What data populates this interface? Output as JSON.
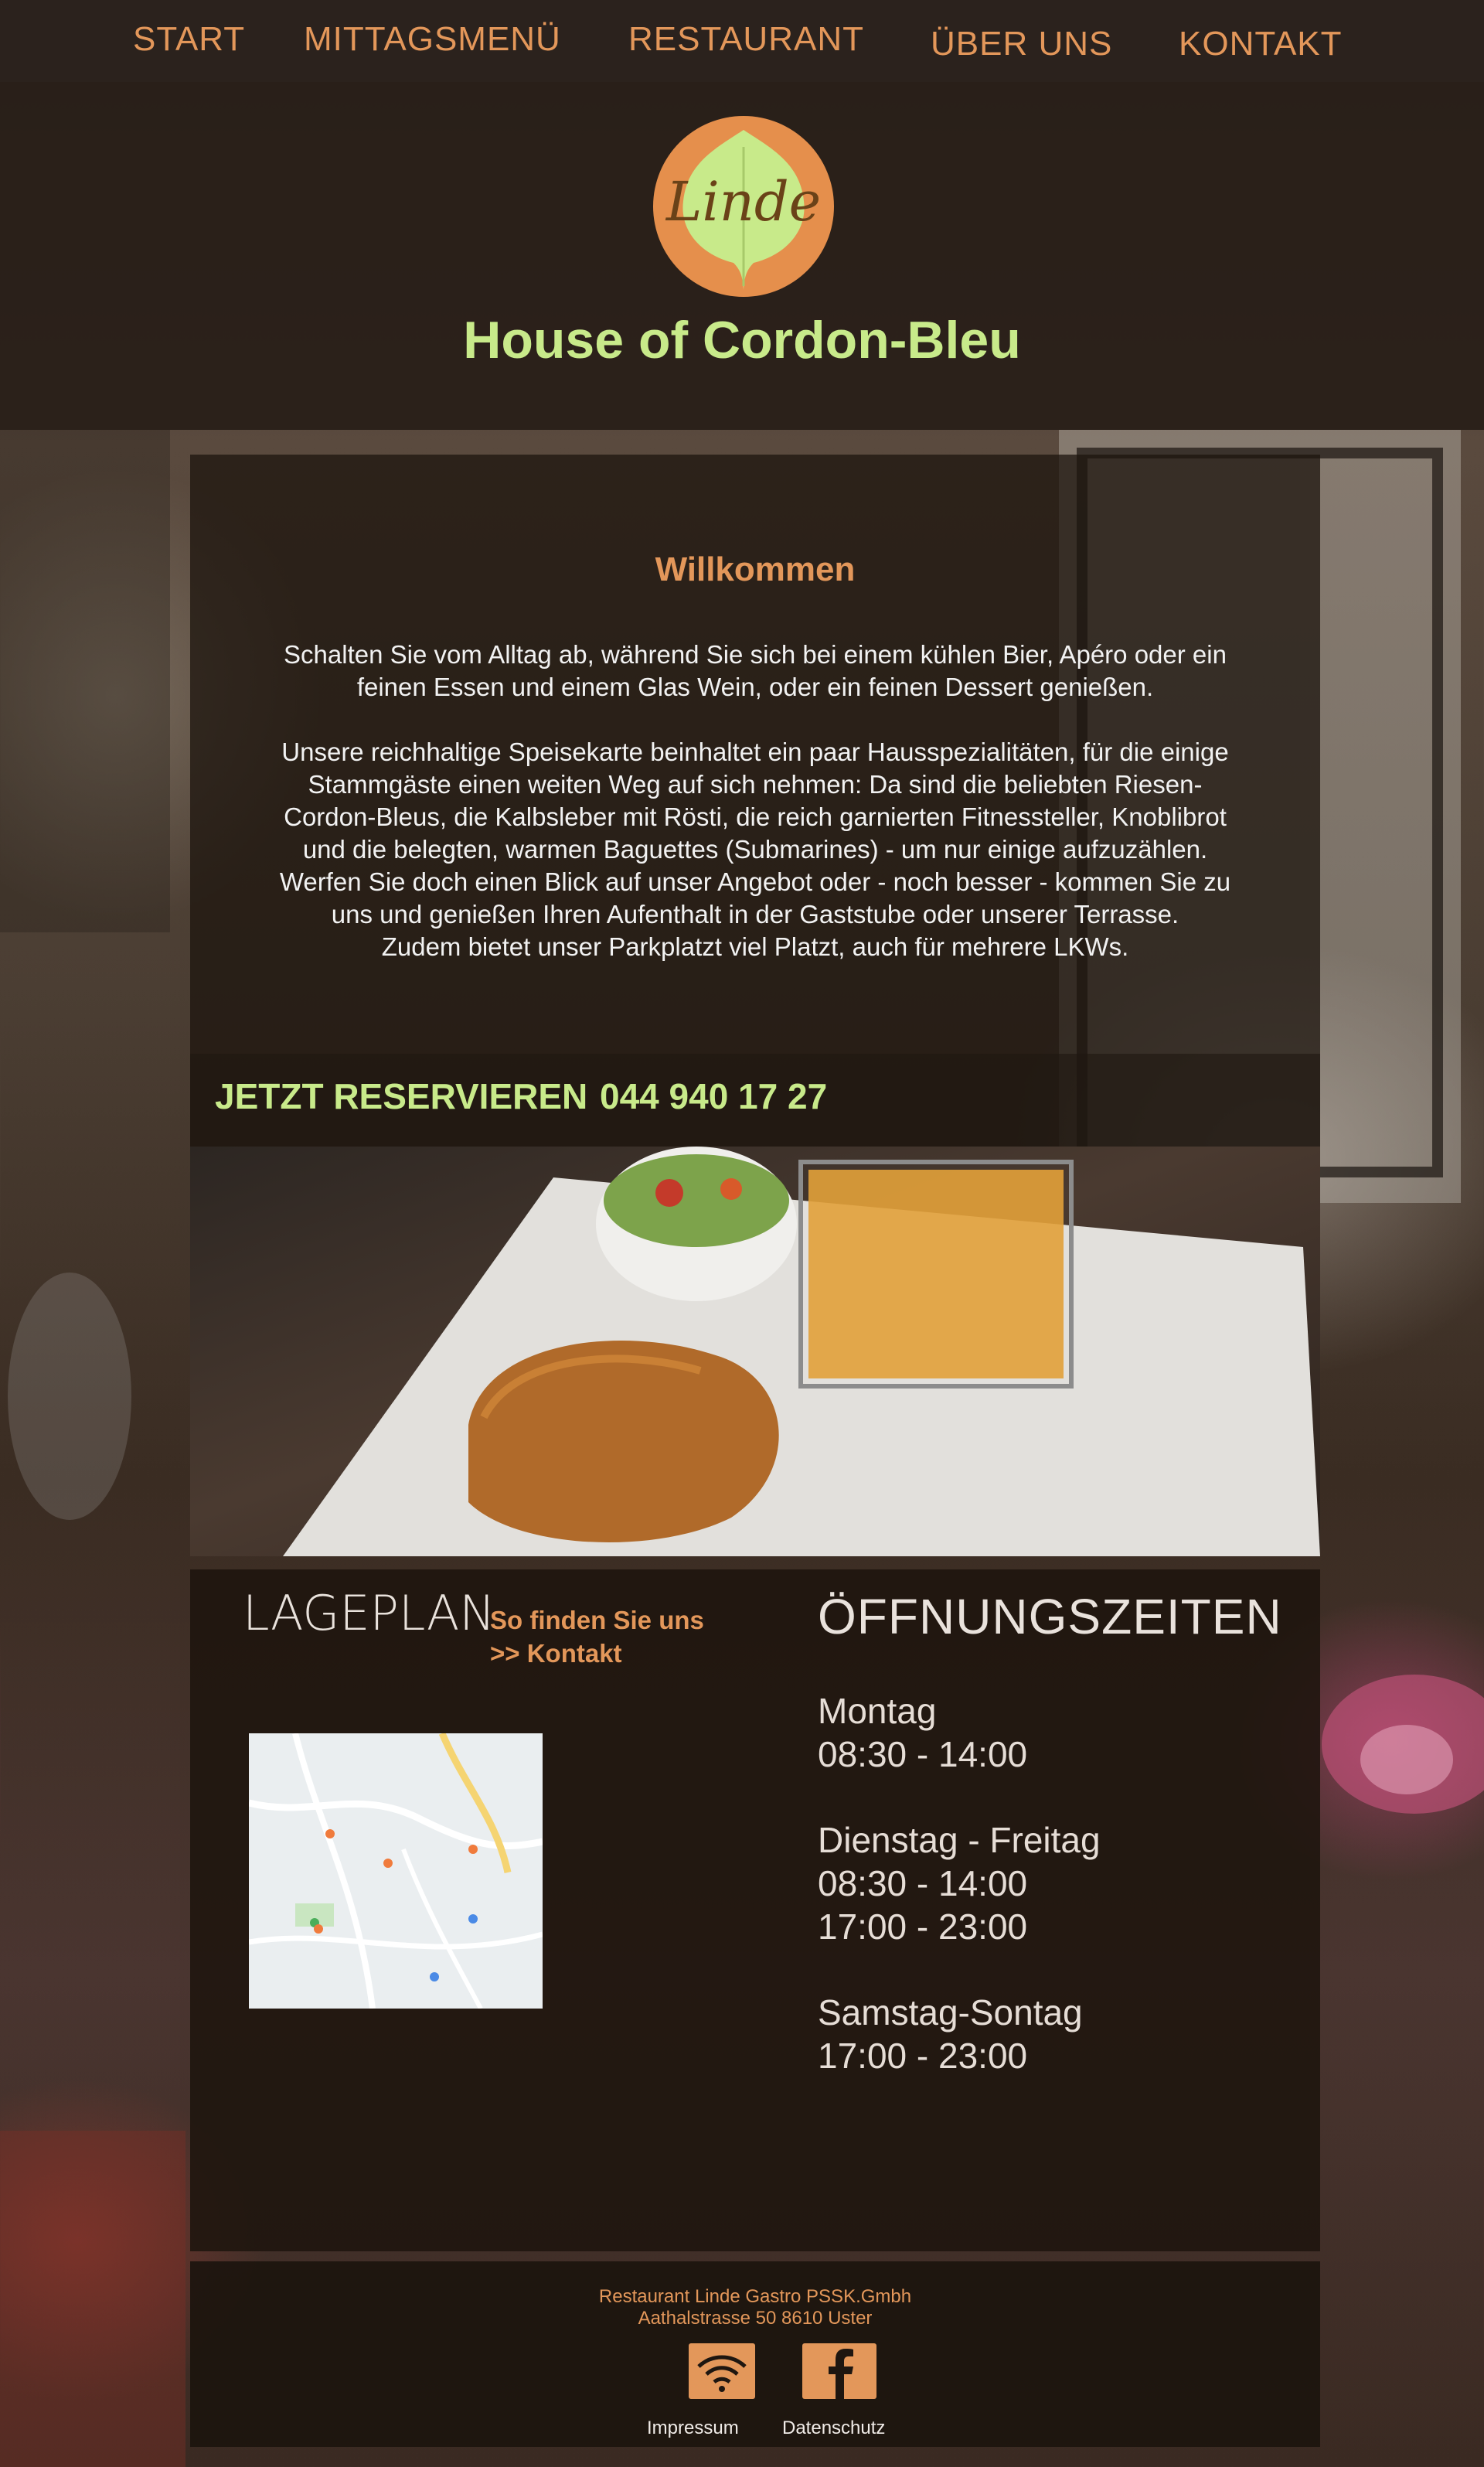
{
  "nav": {
    "items": [
      "START",
      "MITTAGSMENÜ",
      "RESTAURANT",
      "ÜBER UNS",
      "KONTAKT"
    ]
  },
  "header": {
    "logo_text": "Linde",
    "site_title": "House of Cordon-Bleu"
  },
  "welcome": {
    "title": "Willkommen",
    "paragraph1": "Schalten Sie vom Alltag ab, während Sie sich bei einem kühlen Bier, Apéro oder ein feinen Essen und einem Glas Wein, oder ein feinen Dessert genießen.",
    "paragraph2": "Unsere reichhaltige Speisekarte beinhaltet ein paar Hausspezialitäten, für die einige Stammgäste einen weiten Weg auf sich nehmen: Da sind die beliebten Riesen-Cordon-Bleus, die Kalbsleber mit Rösti, die reich garnierten Fitnessteller, Knoblibrot und die belegten, warmen Baguettes (Submarines) - um nur einige aufzuzählen. Werfen Sie doch einen Blick auf unser Angebot oder - noch besser - kommen Sie zu uns und genießen Ihren Aufenthalt in der Gaststube oder unserer Terrasse.",
    "paragraph3": "Zudem bietet unser Parkplatzt viel Platzt, auch für mehrere  LKWs."
  },
  "reserve": {
    "label": "JETZT RESERVIEREN",
    "phone": "044 940 17 27"
  },
  "location": {
    "title": "LAGEPLAN",
    "link1": "So finden Sie uns",
    "link2": ">> Kontakt"
  },
  "hours": {
    "title": "ÖFFNUNGSZEITEN",
    "entries": [
      {
        "day": "Montag",
        "times": [
          "08:30 - 14:00"
        ]
      },
      {
        "day": "Dienstag - Freitag",
        "times": [
          "08:30 - 14:00",
          "17:00 - 23:00"
        ]
      },
      {
        "day": "Samstag-Sontag",
        "times": [
          "17:00 - 23:00"
        ]
      }
    ]
  },
  "footer": {
    "company": "Restaurant Linde Gastro PSSK.Gmbh",
    "address": "Aathalstrasse 50 8610 Uster",
    "icons": [
      "wifi-icon",
      "facebook-icon"
    ],
    "links": [
      "Impressum",
      "Datenschutz"
    ]
  },
  "colors": {
    "accent_orange": "#e3975a",
    "accent_green": "#c8ea8a",
    "logo_orange": "#e58f4c"
  }
}
